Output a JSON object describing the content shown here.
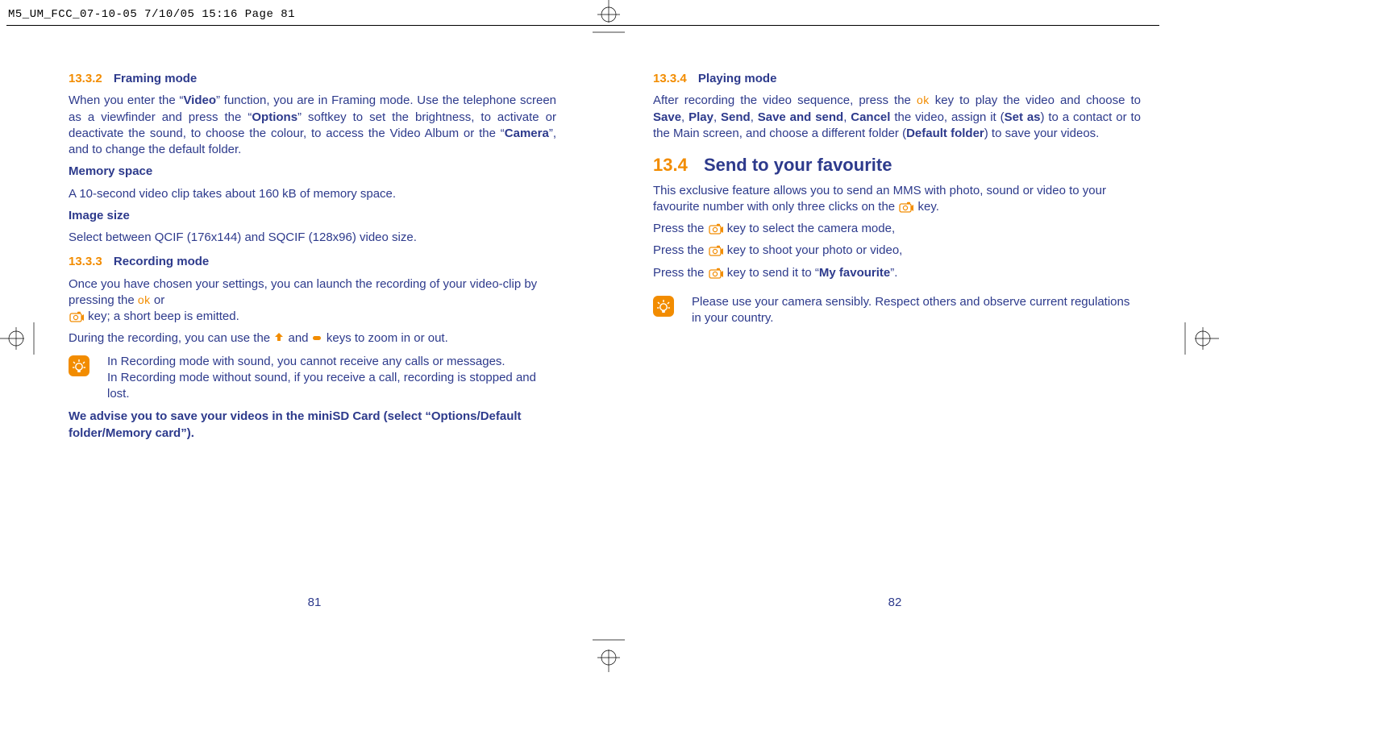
{
  "header": {
    "filestamp": "M5_UM_FCC_07-10-05  7/10/05  15:16  Page 81"
  },
  "left": {
    "s1_num": "13.3.2",
    "s1_title": "Framing mode",
    "p1a": "When you enter the “",
    "p1b": "Video",
    "p1c": "” function, you are in Framing mode. Use the telephone screen as a viewfinder and press the “",
    "p1d": "Options",
    "p1e": "” softkey to set the brightness, to activate or deactivate the sound, to choose the colour, to access the Video Album or the “",
    "p1f": "Camera",
    "p1g": "”, and to change the default folder.",
    "mem_h": "Memory space",
    "mem_p": "A 10-second video clip takes about 160 kB of memory space.",
    "img_h": "Image size",
    "img_p": "Select between QCIF (176x144) and SQCIF (128x96) video size.",
    "s2_num": "13.3.3",
    "s2_title": "Recording mode",
    "rec_p1a": "Once you have chosen your settings, you can launch the recording of your video-clip by pressing the ",
    "rec_p1b": " or ",
    "rec_p1c": " key; a short beep is emitted.",
    "rec_p2a": "During the recording, you can use the ",
    "rec_p2b": " and ",
    "rec_p2c": " keys to zoom in or out.",
    "note1": "In Recording mode with sound, you cannot receive any calls or messages.",
    "note2": "In Recording mode without sound, if you receive a call, recording is stopped and lost.",
    "advise": "We advise you to save your videos in the miniSD Card (select “Options/Default folder/Memory card”).",
    "pagenum": "81"
  },
  "right": {
    "s1_num": "13.3.4",
    "s1_title": "Playing mode",
    "p1a": "After recording the video sequence, press the ",
    "p1b": " key to play the video and choose to ",
    "p1_save": "Save",
    "p1_c1": ", ",
    "p1_play": "Play",
    "p1_c2": ", ",
    "p1_send": "Send",
    "p1_c3": ", ",
    "p1_ss": "Save and send",
    "p1_c4": ", ",
    "p1_cancel": "Cancel",
    "p1d": " the video, assign it (",
    "p1_setas": "Set as",
    "p1e": ") to a contact or to the Main screen, and choose a different folder (",
    "p1_df": "Default folder",
    "p1f": ") to save your videos.",
    "s2_num": "13.4",
    "s2_title": "Send to your favourite",
    "fav_p1a": "This exclusive feature allows you to send an MMS with photo, sound or video to your favourite number with only three clicks on the ",
    "fav_p1b": " key.",
    "fav_l1a": "Press the ",
    "fav_l1b": " key to select the camera mode,",
    "fav_l2a": "Press the ",
    "fav_l2b": " key to shoot your photo or video,",
    "fav_l3a": "Press the ",
    "fav_l3b": " key to send it to “",
    "fav_l3c": "My favourite",
    "fav_l3d": "”.",
    "note": "Please use your camera sensibly. Respect others and observe current regulations in your country.",
    "pagenum": "82"
  },
  "icons": {
    "ok": "ok",
    "camera": "camera-icon",
    "up": "▲",
    "right_arrow": "▬",
    "bulb": "bulb-icon"
  }
}
